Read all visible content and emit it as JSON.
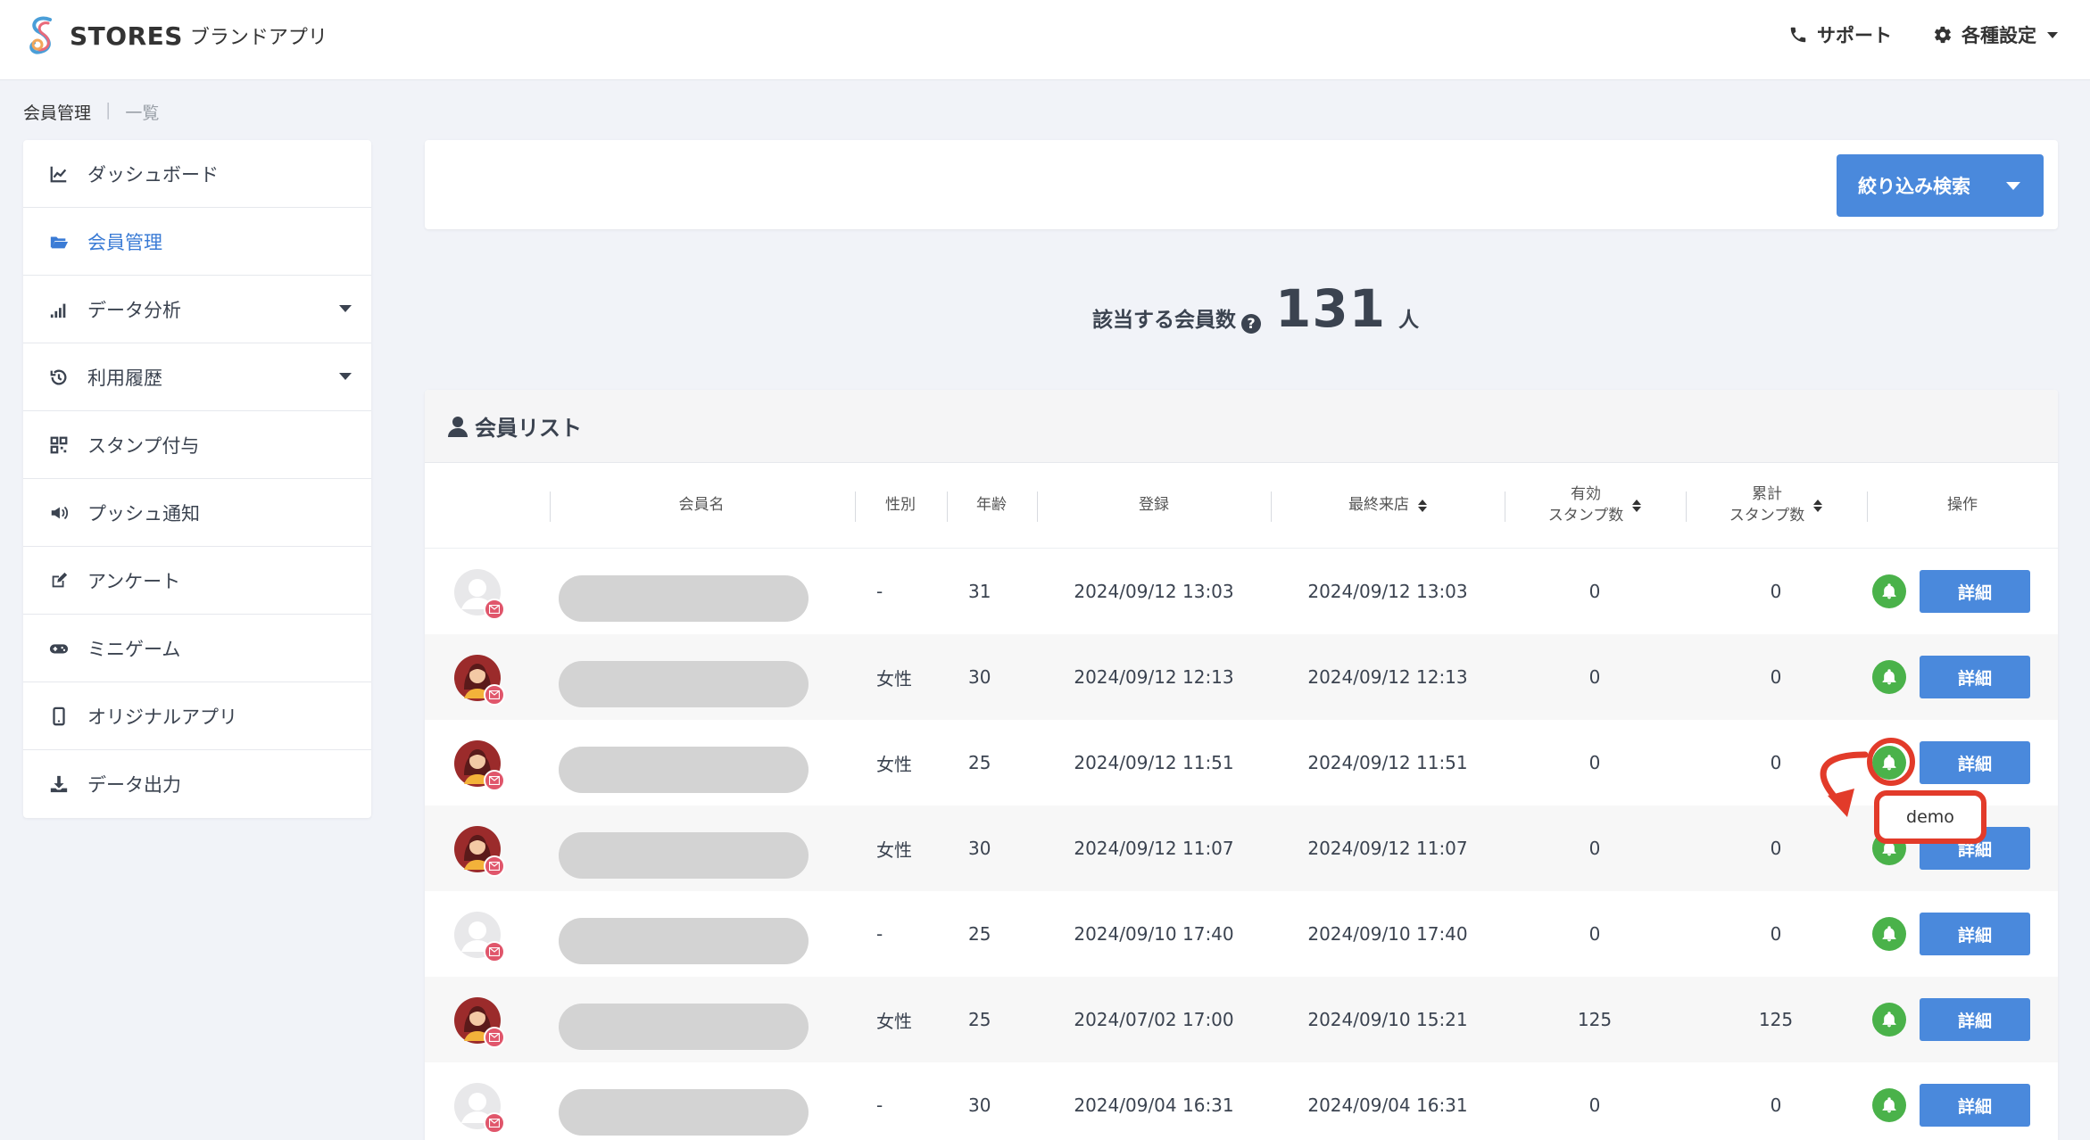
{
  "header": {
    "brand": "STORES",
    "brand_sub": "ブランドアプリ",
    "support": "サポート",
    "settings": "各種設定"
  },
  "breadcrumb": {
    "parent": "会員管理",
    "separator": "|",
    "current": "一覧"
  },
  "sidebar": {
    "items": [
      {
        "label": "ダッシュボード",
        "icon": "chart-line-icon"
      },
      {
        "label": "会員管理",
        "icon": "folder-open-icon",
        "active": true
      },
      {
        "label": "データ分析",
        "icon": "signal-bars-icon",
        "dropdown": true
      },
      {
        "label": "利用履歴",
        "icon": "history-icon",
        "dropdown": true
      },
      {
        "label": "スタンプ付与",
        "icon": "qrcode-icon"
      },
      {
        "label": "プッシュ通知",
        "icon": "megaphone-icon"
      },
      {
        "label": "アンケート",
        "icon": "edit-icon"
      },
      {
        "label": "ミニゲーム",
        "icon": "gamepad-icon"
      },
      {
        "label": "オリジナルアプリ",
        "icon": "mobile-icon"
      },
      {
        "label": "データ出力",
        "icon": "download-icon"
      }
    ]
  },
  "filter": {
    "button_label": "絞り込み検索"
  },
  "summary": {
    "label": "該当する会員数",
    "help": "?",
    "count": "131",
    "unit": "人"
  },
  "list": {
    "title": "会員リスト",
    "columns": {
      "name": "会員名",
      "gender": "性別",
      "age": "年齢",
      "registered": "登録",
      "last_visit": "最終来店",
      "valid_stamps_1": "有効",
      "valid_stamps_2": "スタンプ数",
      "total_stamps_1": "累計",
      "total_stamps_2": "スタンプ数",
      "actions": "操作"
    },
    "detail_label": "詳細",
    "rows": [
      {
        "avatar": "default",
        "gender": "-",
        "age": "31",
        "registered": "2024/09/12 13:03",
        "last_visit": "2024/09/12 13:03",
        "valid": "0",
        "total": "0"
      },
      {
        "avatar": "female",
        "gender": "女性",
        "age": "30",
        "registered": "2024/09/12 12:13",
        "last_visit": "2024/09/12 12:13",
        "valid": "0",
        "total": "0"
      },
      {
        "avatar": "female",
        "gender": "女性",
        "age": "25",
        "registered": "2024/09/12 11:51",
        "last_visit": "2024/09/12 11:51",
        "valid": "0",
        "total": "0"
      },
      {
        "avatar": "female",
        "gender": "女性",
        "age": "30",
        "registered": "2024/09/12 11:07",
        "last_visit": "2024/09/12 11:07",
        "valid": "0",
        "total": "0"
      },
      {
        "avatar": "default",
        "gender": "-",
        "age": "25",
        "registered": "2024/09/10 17:40",
        "last_visit": "2024/09/10 17:40",
        "valid": "0",
        "total": "0"
      },
      {
        "avatar": "female",
        "gender": "女性",
        "age": "25",
        "registered": "2024/07/02 17:00",
        "last_visit": "2024/09/10 15:21",
        "valid": "125",
        "total": "125"
      },
      {
        "avatar": "default",
        "gender": "-",
        "age": "30",
        "registered": "2024/09/04 16:31",
        "last_visit": "2024/09/04 16:31",
        "valid": "0",
        "total": "0"
      }
    ]
  },
  "tooltip": {
    "text": "demo"
  },
  "colors": {
    "accent": "#4a89dc",
    "bell": "#4ab24a",
    "annotation": "#e23b2a",
    "mail_badge": "#e0566b"
  }
}
